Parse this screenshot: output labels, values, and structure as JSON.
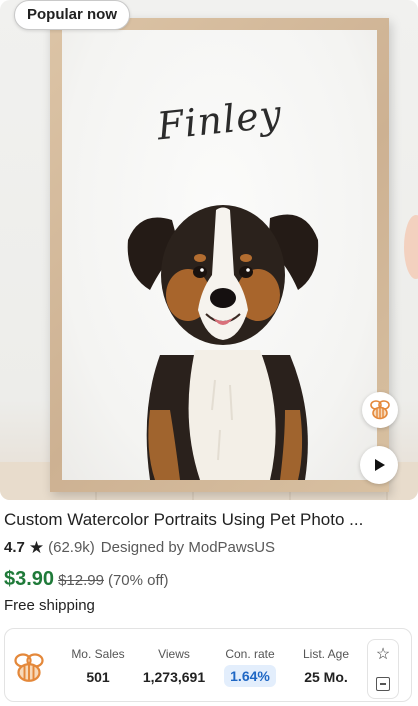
{
  "badge": {
    "label": "Popular now"
  },
  "artwork": {
    "signature": "Finley"
  },
  "listing": {
    "title": "Custom Watercolor Portraits Using Pet Photo ...",
    "rating": "4.7",
    "reviews": "(62.9k)",
    "designer": "Designed by ModPawsUS",
    "sale_price": "$3.90",
    "original_price": "$12.99",
    "discount": "(70% off)",
    "shipping": "Free shipping"
  },
  "icons": {
    "star": "star-icon",
    "bee": "bee-icon",
    "play": "play-icon",
    "favorite": "star-outline-icon",
    "save": "save-icon"
  },
  "stats": {
    "columns": [
      {
        "label": "Mo. Sales",
        "value": "501"
      },
      {
        "label": "Views",
        "value": "1,273,691"
      },
      {
        "label": "Con. rate",
        "value": "1.64%"
      },
      {
        "label": "List. Age",
        "value": "25 Mo."
      }
    ]
  },
  "colors": {
    "sale_price": "#1f7a39",
    "rate_pill_bg": "#e3eefc",
    "rate_pill_text": "#1f67c4",
    "bee_accent": "#e4883a"
  }
}
